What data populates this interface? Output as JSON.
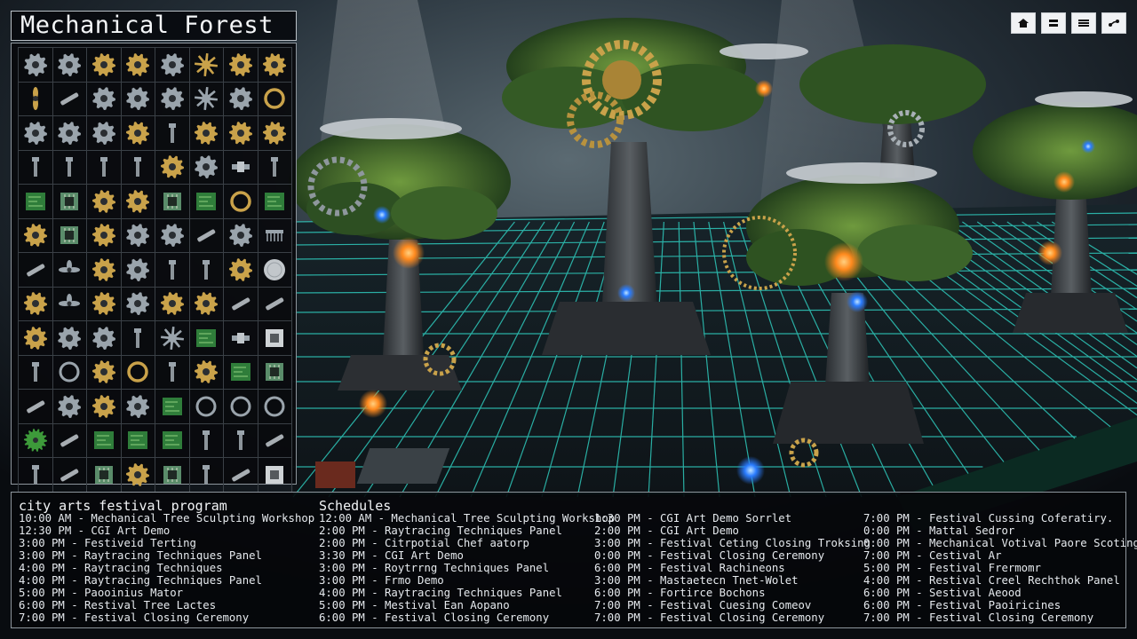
{
  "game": {
    "title": "Mechanical Forest"
  },
  "inventory": {
    "columns": 8,
    "rows": 13,
    "slots": [
      "gear-silver",
      "gear-silver",
      "gear-gold",
      "gear-gold",
      "gear-silver",
      "star-gear-gold",
      "gear-gold",
      "gear-gold",
      "propeller-gold",
      "pipe",
      "gear-silver",
      "gear-silver",
      "gear-silver",
      "star-gear-silver",
      "gear-silver",
      "ring-gold",
      "gear-silver",
      "gear-silver",
      "gear-silver",
      "gear-gold",
      "bolt",
      "gear-gold",
      "gear-gold",
      "gear-gold",
      "bolt",
      "bolt",
      "bolt",
      "bolt",
      "gear-gold",
      "gear-silver",
      "coupler",
      "bolt",
      "circuit-board",
      "circuit-chip",
      "gear-gold",
      "gear-gold",
      "circuit-chip",
      "circuit-board",
      "ring-gold",
      "circuit-board",
      "gear-gold",
      "circuit-chip",
      "gear-gold",
      "gear-silver",
      "gear-silver",
      "pipe",
      "gear-silver",
      "comb",
      "pipe",
      "propeller-silver",
      "gear-gold",
      "gear-silver",
      "bolt",
      "bolt",
      "gear-gold",
      "disc",
      "gear-gold",
      "propeller-silver",
      "gear-gold",
      "gear-silver",
      "gear-gold",
      "gear-gold",
      "pipe",
      "pipe",
      "gear-gold",
      "gear-silver",
      "gear-silver",
      "bolt",
      "star-gear-silver",
      "circuit-board",
      "coupler",
      "panel",
      "bolt",
      "ring-silver",
      "gear-gold",
      "ring-gold",
      "bolt",
      "gear-gold",
      "circuit-board",
      "circuit-chip",
      "pipe",
      "gear-silver",
      "gear-gold",
      "gear-silver",
      "circuit-board",
      "ring-silver",
      "ring-silver",
      "ring-silver",
      "gear-green",
      "pipe",
      "circuit-board",
      "circuit-board",
      "circuit-board",
      "bolt",
      "bolt",
      "pipe",
      "bolt",
      "pipe",
      "circuit-chip",
      "gear-gold",
      "circuit-chip",
      "bolt",
      "pipe",
      "panel"
    ]
  },
  "toolbar": [
    {
      "name": "home-icon"
    },
    {
      "name": "layers-icon"
    },
    {
      "name": "list-icon"
    },
    {
      "name": "route-icon"
    }
  ],
  "program": {
    "heading": "city arts festival program",
    "items": [
      "10:00 AM - Mechanical Tree Sculpting Workshop",
      "12:30 PM - CGI Art Demo",
      "3:00 PM - Festiveid Terting",
      "3:00 PM - Raytracing Techniques Panel",
      "4:00 PM - Raytracing Techniques",
      "4:00 PM - Raytracing Techniques Panel",
      "5:00 PM - Paooinius Mator",
      "6:00 PM - Restival Tree Lactes",
      "7:00 PM - Festival Closing Ceremony"
    ]
  },
  "schedules": {
    "heading": "Schedules",
    "col1": [
      "12:00 AM - Mechanical Tree Sculpting Workshop",
      "2:00 PM - Raytracing Techniques Panel",
      "2:00 PM - Citrpotial Chef aatorp",
      "3:30 PM - CGI Art Demo",
      "3:00 PM - Roytrrng Techniques Panel",
      "3:00 PM - Frmo Demo",
      "4:00 PM - Raytracing Techniques Panel",
      "5:00 PM - Mestival Ean Aopano",
      "6:00 PM - Festival Closing Ceremony"
    ],
    "col2": [
      "1:30 PM - CGI Art Demo Sorrlet",
      "2:00 PM - CGI Art Demo",
      "3:00 PM - Festival Ceting Closing Troksing",
      "0:00 PM - Festival Closing Ceremony",
      "6:00 PM - Festival Rachineons",
      "3:00 PM - Mastaetecn Tnet-Wolet",
      "6:00 PM - Fortirce Bochons",
      "7:00 PM - Festival Cuesing Comeov",
      "7:00 PM - Festival Closing Ceremony"
    ],
    "col3": [
      "7:00 PM - Festival Cussing Coferatiry.",
      "0:00 PM - Mattal Sedror",
      "0:00 PM - Mechanical Votival Paore Scoting",
      "7:00 PM - Cestival Ar",
      "5:00 PM - Festival Frermomr",
      "4:00 PM - Restival Creel Rechthok Panel",
      "6:00 PM - Sestival Aeood",
      "6:00 PM - Festival Paoiricines",
      "7:00 PM - Festival Closing Ceremony"
    ]
  },
  "colors": {
    "panel_border": "#8e969d",
    "grid_glow": "#32e0d0",
    "brass": "#c9a24a",
    "steel": "#9aa4ac",
    "foliage": "#3f6b2e",
    "led_orange": "#ff8a1e",
    "led_blue": "#2a7cff"
  }
}
